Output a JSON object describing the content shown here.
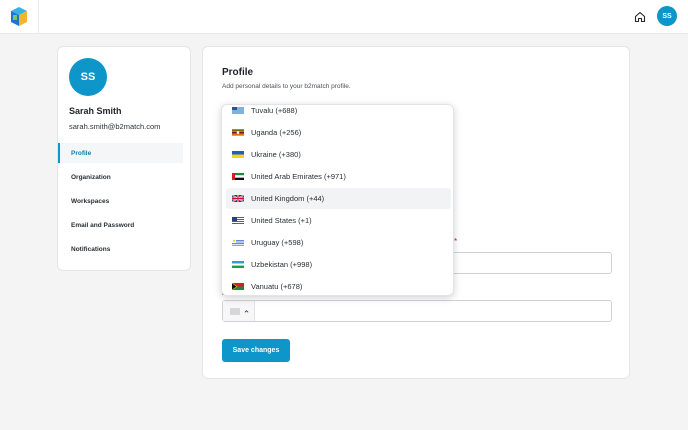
{
  "topbar": {
    "avatar_initials": "SS",
    "accent_color": "#0e95c9"
  },
  "sidebar": {
    "avatar_initials": "SS",
    "name": "Sarah Smith",
    "email": "sarah.smith@b2match.com",
    "nav": [
      {
        "label": "Profile",
        "active": true
      },
      {
        "label": "Organization",
        "active": false
      },
      {
        "label": "Workspaces",
        "active": false
      },
      {
        "label": "Email and Password",
        "active": false
      },
      {
        "label": "Notifications",
        "active": false
      }
    ]
  },
  "main": {
    "title": "Profile",
    "subtitle": "Add personal details to your b2match profile.",
    "required_marker": "*",
    "save_label": "Save changes"
  },
  "country_dropdown": {
    "items": [
      {
        "label": "Tuvalu (+688)",
        "flag_icon": "tuvalu-flag-icon"
      },
      {
        "label": "Uganda (+256)",
        "flag_icon": "uganda-flag-icon"
      },
      {
        "label": "Ukraine (+380)",
        "flag_icon": "ukraine-flag-icon"
      },
      {
        "label": "United Arab Emirates (+971)",
        "flag_icon": "uae-flag-icon"
      },
      {
        "label": "United Kingdom (+44)",
        "flag_icon": "uk-flag-icon",
        "highlighted": true
      },
      {
        "label": "United States (+1)",
        "flag_icon": "us-flag-icon"
      },
      {
        "label": "Uruguay (+598)",
        "flag_icon": "uruguay-flag-icon"
      },
      {
        "label": "Uzbekistan (+998)",
        "flag_icon": "uzbekistan-flag-icon"
      },
      {
        "label": "Vanuatu (+678)",
        "flag_icon": "vanuatu-flag-icon"
      }
    ]
  }
}
